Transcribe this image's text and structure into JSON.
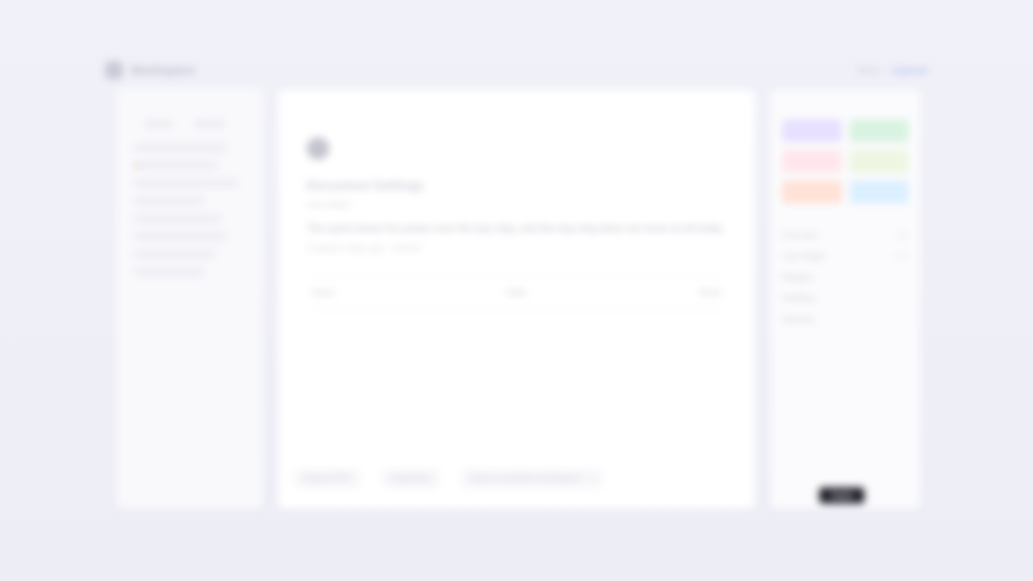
{
  "header": {
    "brand": "Workspace",
    "links": [
      "Docs",
      "Upgrade"
    ]
  },
  "left_panel": {
    "tabs": [
      "Library",
      "Recent"
    ],
    "rows": 8
  },
  "main": {
    "title": "Document Settings",
    "subtitle": "Last edited",
    "body": "The quick brown fox jumps over the lazy dog, and the lazy dog does not move at all today.",
    "meta": "Created 2 days ago · Shared",
    "stats": [
      "Views",
      "Edits",
      "Share"
    ],
    "footer": {
      "chip_left": "Export PDF",
      "chip_mid": "Duplicate",
      "chip_right": "Move to another workspace"
    }
  },
  "right_panel": {
    "swatches": [
      {
        "name": "lavender",
        "color": "#e7e0ff"
      },
      {
        "name": "mint",
        "color": "#d8f3e1"
      },
      {
        "name": "rose",
        "color": "#ffe6ec"
      },
      {
        "name": "sage",
        "color": "#eef6e1"
      },
      {
        "name": "peach",
        "color": "#ffe1d6"
      },
      {
        "name": "sky",
        "color": "#dbefff"
      }
    ],
    "options": [
      {
        "label": "Font size",
        "value": "12"
      },
      {
        "label": "Line height",
        "value": "1.4"
      },
      {
        "label": "Margins",
        "value": ""
      },
      {
        "label": "Padding",
        "value": ""
      },
      {
        "label": "Spacing",
        "value": ""
      }
    ],
    "apply_label": "Apply"
  }
}
